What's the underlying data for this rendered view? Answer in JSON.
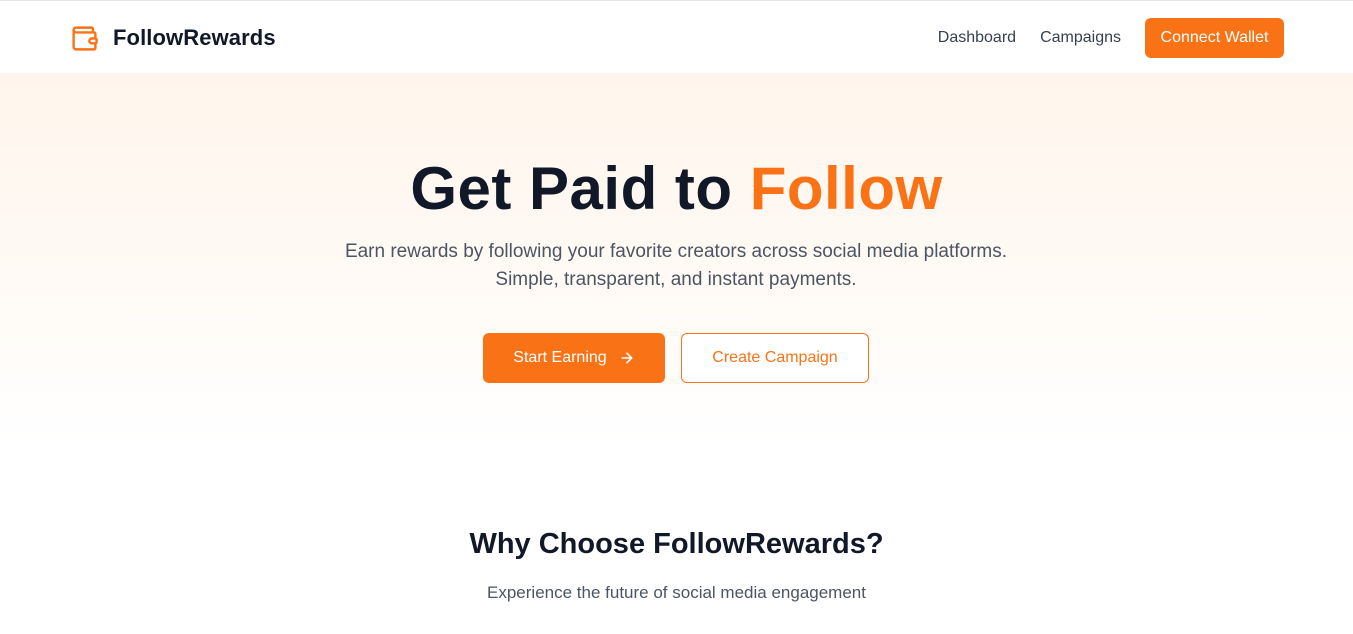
{
  "brand": {
    "name": "FollowRewards",
    "icon": "wallet-icon",
    "accent_color": "#f97316"
  },
  "nav": {
    "links": [
      "Dashboard",
      "Campaigns"
    ],
    "connect_label": "Connect Wallet"
  },
  "hero": {
    "title_main": "Get Paid to ",
    "title_accent": "Follow",
    "subtitle": "Earn rewards by following your favorite creators across social media platforms. Simple, transparent, and instant payments.",
    "primary_cta": "Start Earning",
    "primary_cta_icon": "arrow-right-icon",
    "secondary_cta": "Create Campaign"
  },
  "features": {
    "title": "Why Choose FollowRewards?",
    "subtitle": "Experience the future of social media engagement"
  }
}
